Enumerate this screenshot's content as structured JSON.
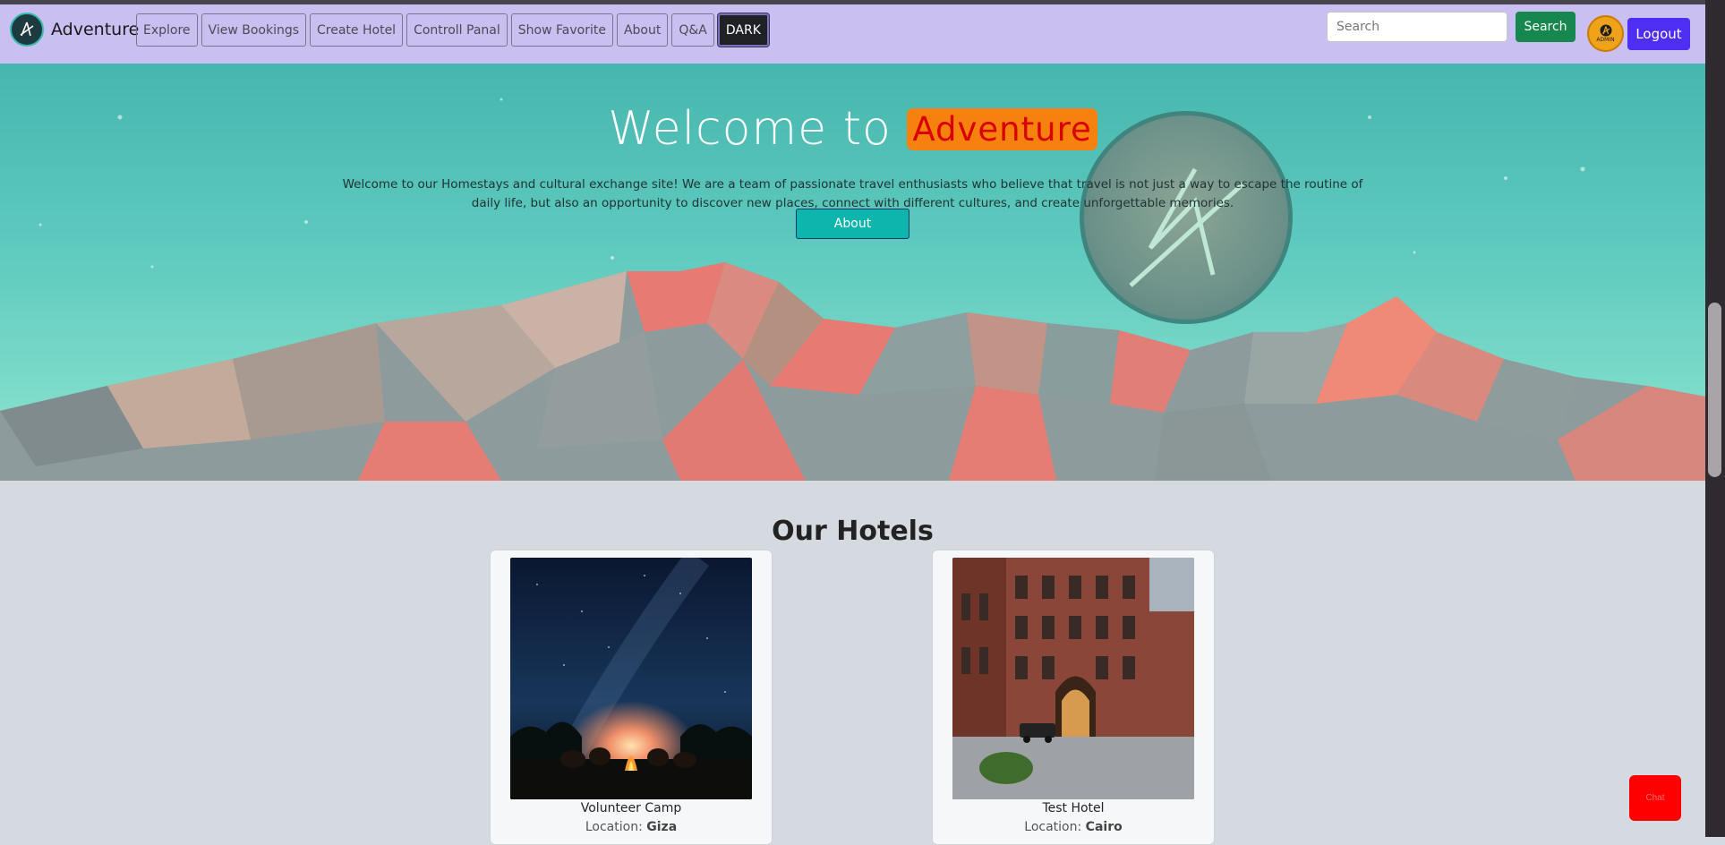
{
  "navbar": {
    "brand_name": "Adventure",
    "links": [
      "Explore",
      "View Bookings",
      "Create Hotel",
      "Controll Panal",
      "Show Favorite",
      "About",
      "Q&A"
    ],
    "dark_label": "DARK",
    "search_placeholder": "Search",
    "search_button": "Search",
    "avatar_text": "ADMIN",
    "logout_label": "Logout"
  },
  "hero": {
    "title_prefix": "Welcome to",
    "title_highlight": "Adventure",
    "description": "Welcome to our Homestays and cultural exchange site! We are a team of passionate travel enthusiasts who believe that travel is not just a way to escape the routine of daily life, but also an opportunity to discover new places, connect with different cultures, and create unforgettable memories.",
    "about_button": "About"
  },
  "hotels": {
    "section_title": "Our Hotels",
    "location_label": "Location:",
    "items": [
      {
        "name": "Volunteer Camp",
        "location": "Giza"
      },
      {
        "name": "Test Hotel",
        "location": "Cairo"
      }
    ]
  },
  "floating_button": {
    "label": "Chat"
  },
  "colors": {
    "navbar": "#c9bff0",
    "hero_teal": "#4fbdb3",
    "highlight_orange": "#f7810e",
    "highlight_text": "#d90000",
    "search_green": "#16884f",
    "logout_purple": "#4e2ef2",
    "fab_red": "#ff0000"
  }
}
